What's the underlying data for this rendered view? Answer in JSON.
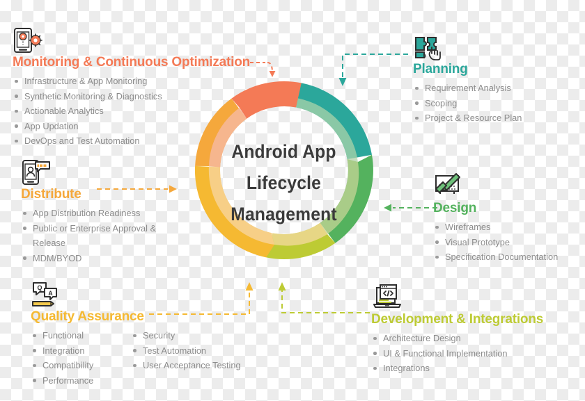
{
  "center": {
    "line1": "Android App",
    "line2": "Lifecycle",
    "line3": "Management",
    "color": "#3b3b3b"
  },
  "colors": {
    "monitoring": "#F47A56",
    "planning": "#2BA79B",
    "design": "#54B25E",
    "development": "#BDCB34",
    "quality": "#F5B932",
    "distribute": "#F5A83C",
    "bullet_text": "#8c8c8c"
  },
  "sections": [
    {
      "key": "monitoring",
      "title": "Monitoring & Continuous Optimization",
      "color": "#F47A56",
      "icon": "phone-gears-icon",
      "items": [
        "Infrastructure & App Monitoring",
        "Synthetic Monitoring & Diagnostics",
        "Actionable Analytics",
        "App Updation",
        "DevOps and Test Automation"
      ]
    },
    {
      "key": "planning",
      "title": "Planning",
      "color": "#2BA79B",
      "icon": "puzzle-hand-icon",
      "items": [
        "Requirement Analysis",
        "Scoping",
        "Project & Resource Plan"
      ]
    },
    {
      "key": "design",
      "title": "Design",
      "color": "#54B25E",
      "icon": "pencil-ruler-board-icon",
      "items": [
        "Wireframes",
        "Visual Prototype",
        "Specification Documentation"
      ]
    },
    {
      "key": "development",
      "title": "Development & Integrations",
      "color": "#BDCB34",
      "icon": "laptop-code-icon",
      "items": [
        "Architecture Design",
        "UI & Functional Implementation",
        "Integrations"
      ]
    },
    {
      "key": "quality",
      "title": "Quality Assurance",
      "color": "#F5B932",
      "icon": "qa-bubbles-pencil-icon",
      "items_col1": [
        "Functional",
        "Integration",
        "Compatibility",
        "Performance"
      ],
      "items_col2": [
        "Security",
        "Test Automation",
        "User Acceptance Testing"
      ]
    },
    {
      "key": "distribute",
      "title": "Distribute",
      "color": "#F5A83C",
      "icon": "phone-share-icon",
      "items": [
        "App Distribution Readiness",
        "Public or Enterprise Approval &",
        "Release",
        "MDM/BYOD"
      ]
    }
  ],
  "ring": {
    "segments": [
      {
        "name": "planning-segment",
        "color": "#2BA79B"
      },
      {
        "name": "design-segment",
        "color": "#54B25E"
      },
      {
        "name": "development-segment",
        "color": "#BDCB34"
      },
      {
        "name": "quality-segment",
        "color": "#F5B932"
      },
      {
        "name": "distribute-segment",
        "color": "#F5A83C"
      },
      {
        "name": "monitoring-segment",
        "color": "#F47A56"
      }
    ]
  }
}
